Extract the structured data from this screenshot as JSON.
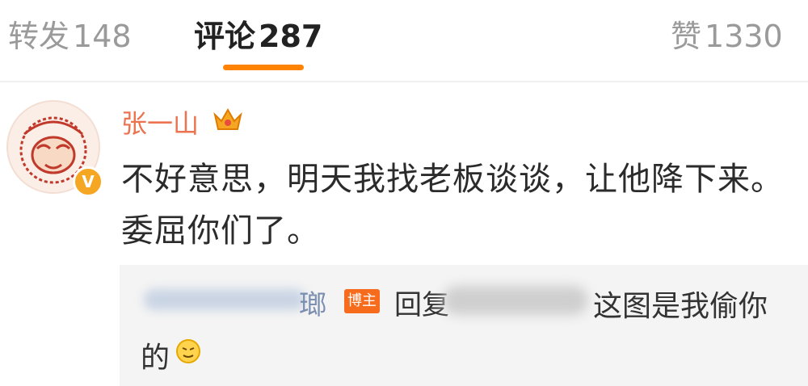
{
  "tabs": [
    {
      "label": "转发",
      "count": "148"
    },
    {
      "label": "评论",
      "count": "287"
    },
    {
      "label": "赞",
      "count": "1330"
    }
  ],
  "comment": {
    "username": "张一山",
    "text": "不好意思，明天我找老板谈谈，让他降下来。委屈你们了。"
  },
  "reply": {
    "name_tail": "瑯",
    "badge": "博主",
    "verb": "回复",
    "text_line1": "这图是我偷你",
    "text_line2": "的"
  },
  "colors": {
    "accent": "#ff8200",
    "username": "#eb7350",
    "badge": "#f76b1c"
  },
  "icons": [
    "crown-icon",
    "verified-badge-icon",
    "emoji-icon"
  ]
}
